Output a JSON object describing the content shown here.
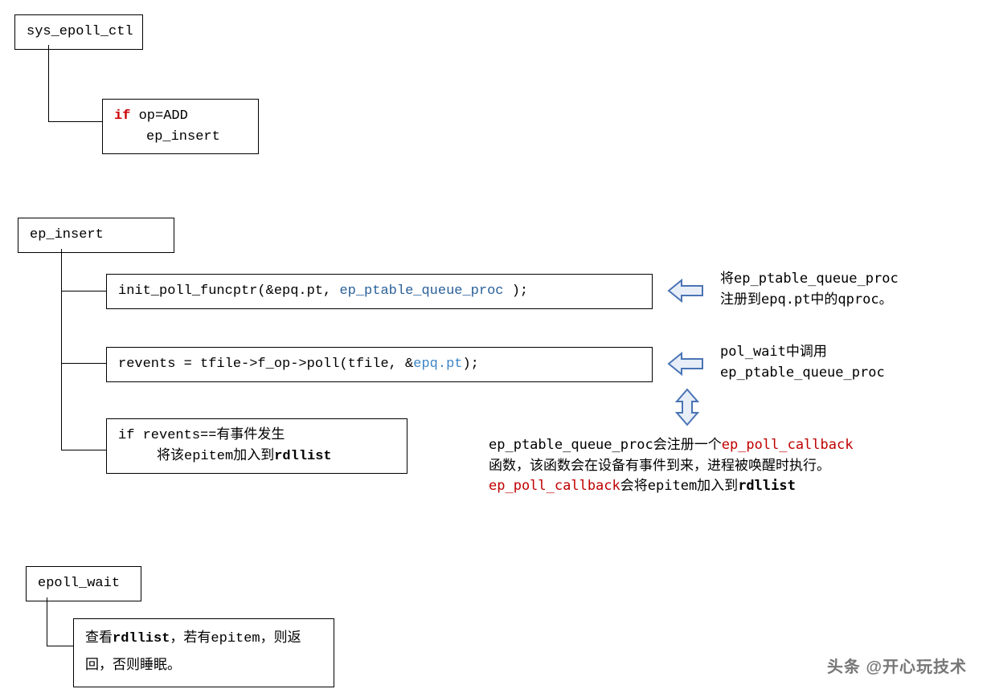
{
  "boxes": {
    "sys_epoll_ctl": "sys_epoll_ctl",
    "if_op": {
      "if": "if",
      "cond": " op=ADD",
      "body": "ep_insert"
    },
    "ep_insert": "ep_insert",
    "init_poll": {
      "pre": "init_poll_funcptr(&epq.pt, ",
      "fn": "ep_ptable_queue_proc",
      "post": " );"
    },
    "revents": {
      "pre": "revents = tfile->f_op->poll(tfile, &",
      "arg": "epq.pt",
      "post": ");"
    },
    "if_revents": {
      "cond": "if revents==有事件发生",
      "body_pre": "将该epitem加入到",
      "body_bold": "rdllist"
    },
    "epoll_wait": "epoll_wait",
    "wait_body": {
      "pre": "查看",
      "bold": "rdllist",
      "post": "，若有epitem，则返回，否则睡眠。"
    }
  },
  "exp": {
    "e1_l1": "将ep_ptable_queue_proc",
    "e1_l2": "注册到epq.pt中的qproc。",
    "e2_l1": "pol_wait中调用",
    "e2_l2": "ep_ptable_queue_proc",
    "e3_l1_pre": "ep_ptable_queue_proc会注册一个",
    "e3_l1_red": "ep_poll_callback",
    "e3_l2": "函数，该函数会在设备有事件到来，进程被唤醒时执行。",
    "e3_l3_red": "ep_poll_callback",
    "e3_l3_mid": "会将epitem加入到",
    "e3_l3_bold": "rdllist"
  },
  "watermark": "头条 @开心玩技术"
}
